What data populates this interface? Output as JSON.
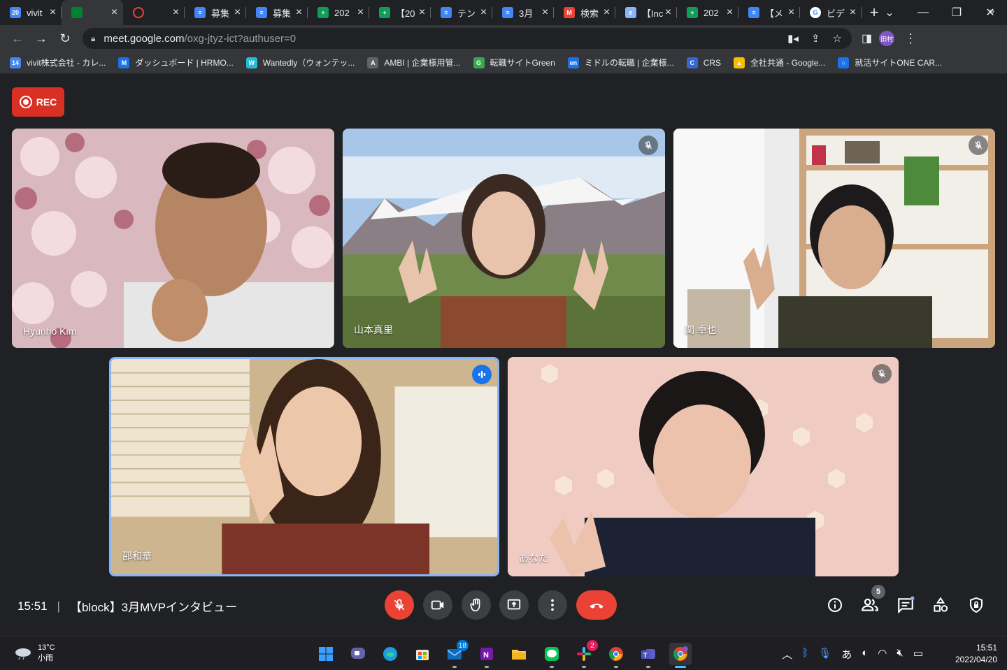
{
  "browser": {
    "tabs": [
      {
        "icon": "calendar-icon",
        "title": "vivit",
        "color": "#4285f4",
        "glyph": "20"
      },
      {
        "icon": "meet-icon",
        "title": "",
        "color": "#00832d",
        "glyph": ""
      },
      {
        "icon": "recording-icon",
        "title": "",
        "color": "#ea4335",
        "glyph": ""
      },
      {
        "icon": "docs-icon",
        "title": "募集",
        "color": "#4285f4",
        "glyph": "≡"
      },
      {
        "icon": "docs-icon",
        "title": "募集",
        "color": "#4285f4",
        "glyph": "≡"
      },
      {
        "icon": "sheets-icon",
        "title": "202",
        "color": "#0f9d58",
        "glyph": "+"
      },
      {
        "icon": "sheets-icon",
        "title": "【20",
        "color": "#0f9d58",
        "glyph": "+"
      },
      {
        "icon": "docs-icon",
        "title": "テン",
        "color": "#4285f4",
        "glyph": "≡"
      },
      {
        "icon": "docs-icon",
        "title": "3月",
        "color": "#4285f4",
        "glyph": "≡"
      },
      {
        "icon": "gmail-icon",
        "title": "検索",
        "color": "#ea4335",
        "glyph": "M"
      },
      {
        "icon": "web-icon",
        "title": "【Inc",
        "color": "#8ab4f8",
        "glyph": "e"
      },
      {
        "icon": "sheets-icon",
        "title": "202",
        "color": "#0f9d58",
        "glyph": "+"
      },
      {
        "icon": "docs-icon",
        "title": "【メ",
        "color": "#4285f4",
        "glyph": "≡"
      },
      {
        "icon": "google-icon",
        "title": "ビデ",
        "color": "#ffffff",
        "glyph": "G"
      }
    ],
    "active_tab": 1,
    "url_host": "meet.google.com",
    "url_path": "/oxg-jtyz-ict?authuser=0",
    "profile_label": "田村",
    "bookmarks": [
      {
        "label": "vivit株式会社 - カレ...",
        "icon": "calendar-icon",
        "color": "#4285f4",
        "glyph": "14"
      },
      {
        "label": "ダッシュボード | HRMO...",
        "icon": "hrmos-icon",
        "color": "#1a73e8",
        "glyph": "M"
      },
      {
        "label": "Wantedly（ウォンテッ...",
        "icon": "wantedly-icon",
        "color": "#21bddb",
        "glyph": "W"
      },
      {
        "label": "AMBI | 企業様用管...",
        "icon": "ambi-icon",
        "color": "#5f6368",
        "glyph": "A"
      },
      {
        "label": "転職サイトGreen",
        "icon": "green-icon",
        "color": "#34a853",
        "glyph": "G"
      },
      {
        "label": "ミドルの転職 | 企業様...",
        "icon": "en-icon",
        "color": "#1a73e8",
        "glyph": "en"
      },
      {
        "label": "CRS",
        "icon": "crs-icon",
        "color": "#3367d6",
        "glyph": "C"
      },
      {
        "label": "全社共通 - Google...",
        "icon": "drive-icon",
        "color": "#fbbc04",
        "glyph": "▲"
      },
      {
        "label": "就活サイトONE CAR...",
        "icon": "onecareer-icon",
        "color": "#1a73e8",
        "glyph": "○"
      }
    ],
    "more_bookmarks": "»"
  },
  "meet": {
    "rec_label": "REC",
    "participants": [
      {
        "name": "Hyunho Kim",
        "muted": false,
        "speaking": false
      },
      {
        "name": "山本真里",
        "muted": true,
        "speaking": false
      },
      {
        "name": "関 卓也",
        "muted": true,
        "speaking": false
      },
      {
        "name": "邵和華",
        "muted": false,
        "speaking": true
      },
      {
        "name": "あなた",
        "muted": true,
        "speaking": false
      }
    ],
    "time": "15:51",
    "meeting_title": "【block】3月MVPインタビュー",
    "participant_count": "5",
    "colors": {
      "mic_off": "#ea4335",
      "end_call": "#ea4335",
      "speaking_border": "#8ab4f8"
    }
  },
  "taskbar": {
    "temperature": "13°C",
    "weather": "小雨",
    "mail_badge": "18",
    "slack_badge": "2",
    "ime": "あ",
    "clock_time": "15:51",
    "clock_date": "2022/04/20"
  }
}
